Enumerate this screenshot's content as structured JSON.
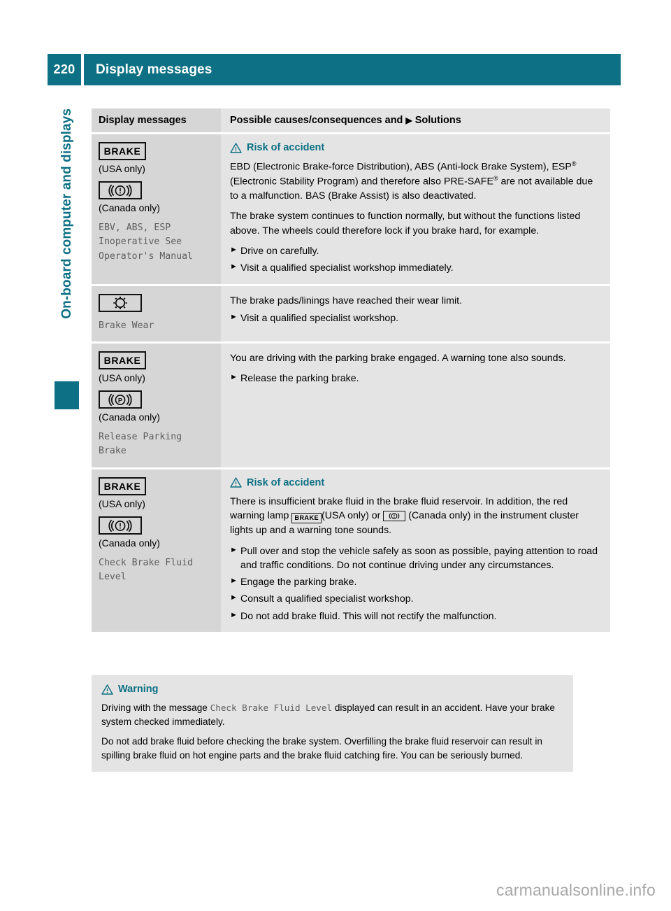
{
  "header": {
    "page_number": "220",
    "title": "Display messages",
    "accent_color": "#0d7084"
  },
  "chapter_tab": {
    "label": "On-board computer and displays",
    "color": "#0d7084"
  },
  "table": {
    "columns": {
      "left": "Display messages",
      "right_pre": "Possible causes/consequences and",
      "right_marker": "▶",
      "right_post": "Solutions"
    },
    "rows": [
      {
        "left": {
          "icon_usa": "brake-word-icon",
          "icon_usa_text": "BRAKE",
          "note_usa": "(USA only)",
          "icon_canada": "brake-circle-exclamation-icon",
          "note_canada": "(Canada only)",
          "display_text": "EBV, ABS, ESP\nInoperative See\nOperator's Manual"
        },
        "right": {
          "hazard_icon": "warning-triangle-icon",
          "hazard_title": "Risk of accident",
          "paragraphs": [
            "EBD (Electronic Brake-force Distribution), ABS (Anti-lock Brake System), ESP® (Electronic Stability Program) and therefore also PRE-SAFE® are not available due to a malfunction. BAS (Brake Assist) is also deactivated.",
            "The brake system continues to function normally, but without the functions listed above. The wheels could therefore lock if you brake hard, for example."
          ],
          "bullets": [
            "Drive on carefully.",
            "Visit a qualified specialist workshop immediately."
          ]
        }
      },
      {
        "left": {
          "icon_wear": "brake-wear-icon",
          "display_text": "Brake Wear"
        },
        "right": {
          "paragraphs": [
            "The brake pads/linings have reached their wear limit."
          ],
          "bullets": [
            "Visit a qualified specialist workshop."
          ]
        }
      },
      {
        "left": {
          "icon_usa": "brake-word-icon",
          "icon_usa_text": "BRAKE",
          "note_usa": "(USA only)",
          "icon_canada": "parking-brake-p-icon",
          "note_canada": "(Canada only)",
          "display_text": "Release Parking\nBrake"
        },
        "right": {
          "paragraphs": [
            "You are driving with the parking brake engaged. A warning tone also sounds."
          ],
          "bullets": [
            "Release the parking brake."
          ]
        }
      },
      {
        "left": {
          "icon_usa": "brake-word-icon",
          "icon_usa_text": "BRAKE",
          "note_usa": "(USA only)",
          "icon_canada": "brake-circle-exclamation-icon",
          "note_canada": "(Canada only)",
          "display_text": "Check Brake Fluid\nLevel"
        },
        "right": {
          "hazard_icon": "warning-triangle-icon",
          "hazard_title": "Risk of accident",
          "paragraph_parts": {
            "p1a": "There is insufficient brake fluid in the brake fluid reservoir. In addition, the red warning lamp",
            "inline_icon_1": "BRAKE",
            "p1b": "(USA only) or",
            "inline_icon_2": "brake-circle-exclamation-icon",
            "p1c": "(Canada only) in the instrument cluster lights up and a warning tone sounds."
          },
          "bullets": [
            "Pull over and stop the vehicle safely as soon as possible, paying attention to road and traffic conditions. Do not continue driving under any circumstances.",
            "Engage the parking brake.",
            "Consult a qualified specialist workshop.",
            "Do not add brake fluid. This will not rectify the malfunction."
          ]
        }
      }
    ]
  },
  "warning_box": {
    "hazard_icon": "warning-triangle-icon",
    "title": "Warning",
    "p1a": "Driving with the message",
    "p1_mono": "Check Brake Fluid Level",
    "p1b": "displayed can result in an accident. Have your brake system checked immediately.",
    "p2": "Do not add brake fluid before checking the brake system. Overfilling the brake fluid reservoir can result in spilling brake fluid on hot engine parts and the brake fluid catching fire. You can be seriously burned."
  },
  "footer": {
    "watermark": "carmanualsonline.info"
  }
}
